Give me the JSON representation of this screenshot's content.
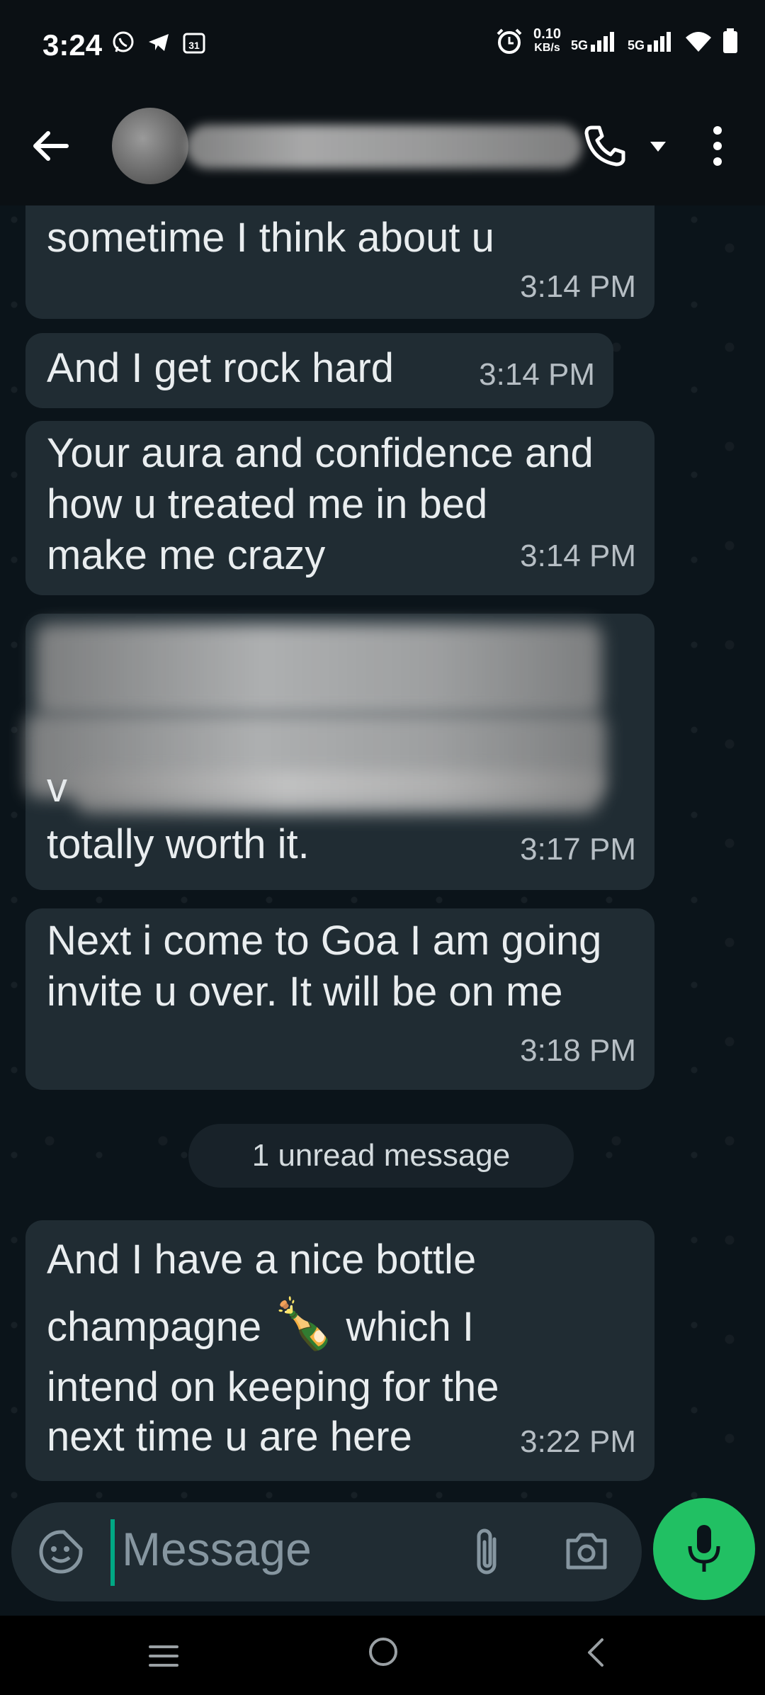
{
  "status_bar": {
    "time": "3:24",
    "speed_value": "0.10",
    "speed_unit": "KB/s",
    "net1": "5G",
    "net2": "5G"
  },
  "header": {
    "contact_name": ""
  },
  "messages": [
    {
      "text": "sometime I think about u",
      "time": "3:14 PM"
    },
    {
      "text": "And I get rock hard",
      "time": "3:14 PM"
    },
    {
      "text": "Your aura and confidence and how u treated me in bed make me crazy",
      "time": "3:14 PM"
    },
    {
      "text_visible_end": "totally worth it.",
      "partial_first_letter": "v",
      "time": "3:17 PM"
    },
    {
      "text": "Next i come to Goa I am going invite u over. It will be on me",
      "time": "3:18 PM"
    },
    {
      "text_line1": "And I have a nice bottle",
      "text_line2a": "champagne ",
      "emoji": "🍾",
      "text_line2b": " which I",
      "text_line3": "intend on keeping for the",
      "text_line4": "next time u are here",
      "time": "3:22 PM"
    }
  ],
  "unread_banner": "1 unread message",
  "input": {
    "placeholder": "Message"
  },
  "colors": {
    "bubble": "#202c33",
    "background": "#0b141a",
    "accent_green": "#21c063"
  }
}
